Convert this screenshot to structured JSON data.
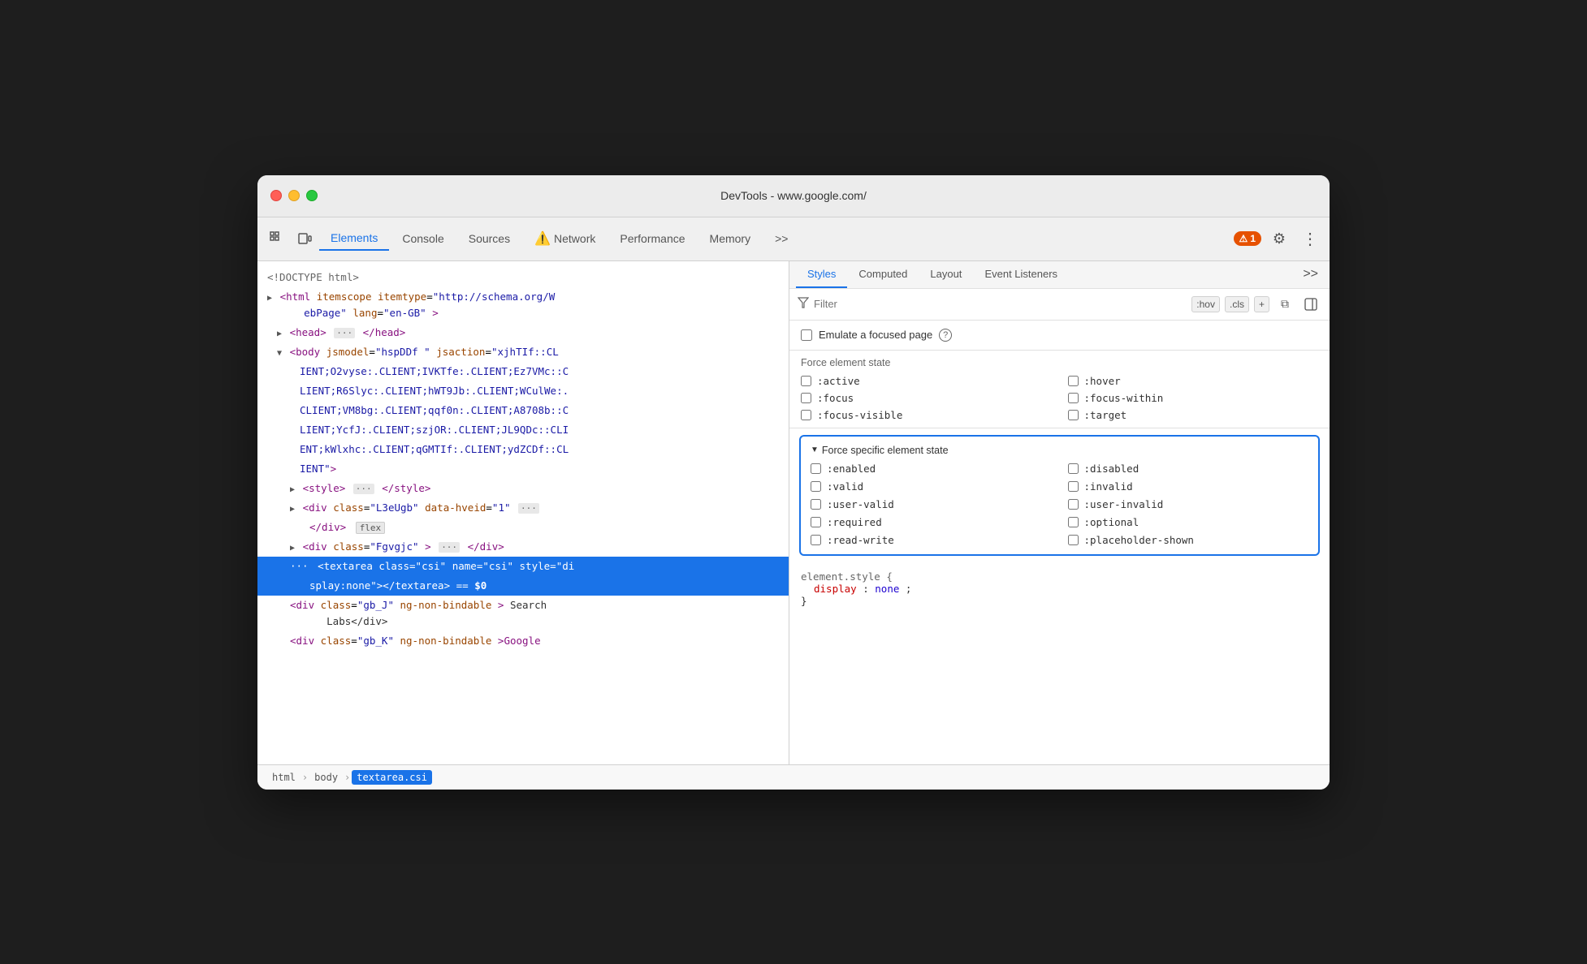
{
  "window": {
    "title": "DevTools - www.google.com/"
  },
  "toolbar": {
    "tabs": [
      {
        "id": "elements",
        "label": "Elements",
        "active": true
      },
      {
        "id": "console",
        "label": "Console",
        "active": false
      },
      {
        "id": "sources",
        "label": "Sources",
        "active": false
      },
      {
        "id": "network",
        "label": "Network",
        "active": false,
        "hasWarning": true
      },
      {
        "id": "performance",
        "label": "Performance",
        "active": false
      },
      {
        "id": "memory",
        "label": "Memory",
        "active": false
      }
    ],
    "more_tabs_label": ">>",
    "notification_count": "1",
    "settings_label": "⚙",
    "more_options_label": "⋮"
  },
  "dom": {
    "lines": [
      {
        "indent": 0,
        "content": "<!DOCTYPE html>",
        "type": "doctype"
      },
      {
        "indent": 0,
        "content": "<html itemscope itemtype=\"http://schema.org/W\nebPage\" lang=\"en-GB\">",
        "type": "tag"
      },
      {
        "indent": 1,
        "content": "<head>",
        "type": "tag",
        "ellipsis": true,
        "collapsed": true
      },
      {
        "indent": 1,
        "content": "<body jsmodel=\"hspDDf \" jsaction=\"xjhTIf::CL\nIENT;O2vyse:.CLIENT;IVKTfe:.CLIENT;Ez7VMc::C\nLIENT;R6Slyc:.CLIENT;hWT9Jb:.CLIENT;WCulWe:.\nCLIENT;VM8bg:.CLIENT;qqf0n:.CLIENT;A8708b::C\nLIENT;YcfJ:.CLIENT;szjOR:.CLIENT;JL9QDc::CLI\nENT;kWlxhc:.CLIENT;qGMTIf:.CLIENT;ydZCDf::CL\nIENT\">",
        "type": "tag",
        "collapsed": false
      }
    ]
  },
  "breadcrumb": {
    "items": [
      {
        "label": "html",
        "active": false
      },
      {
        "label": "body",
        "active": false
      },
      {
        "label": "textarea.csi",
        "active": true
      }
    ]
  },
  "styles_panel": {
    "tabs": [
      {
        "id": "styles",
        "label": "Styles",
        "active": true
      },
      {
        "id": "computed",
        "label": "Computed",
        "active": false
      },
      {
        "id": "layout",
        "label": "Layout",
        "active": false
      },
      {
        "id": "event_listeners",
        "label": "Event Listeners",
        "active": false
      }
    ],
    "more_tabs": ">>",
    "filter": {
      "placeholder": "Filter",
      "hov_label": ":hov",
      "cls_label": ".cls",
      "add_label": "+",
      "copy_label": "⧉",
      "toggle_label": "⊞"
    },
    "emulate": {
      "label": "Emulate a focused page",
      "help": "?"
    },
    "force_element_state": {
      "title": "Force element state",
      "states_left": [
        ":active",
        ":focus",
        ":focus-visible"
      ],
      "states_right": [
        ":hover",
        ":focus-within",
        ":target"
      ]
    },
    "force_specific_element_state": {
      "title": "Force specific element state",
      "states_left": [
        ":enabled",
        ":valid",
        ":user-valid",
        ":required",
        ":read-write"
      ],
      "states_right": [
        ":disabled",
        ":invalid",
        ":user-invalid",
        ":optional",
        ":placeholder-shown"
      ]
    },
    "element_style": {
      "selector": "element.style {",
      "property_name": "display",
      "property_value": "none",
      "close": "}"
    }
  }
}
